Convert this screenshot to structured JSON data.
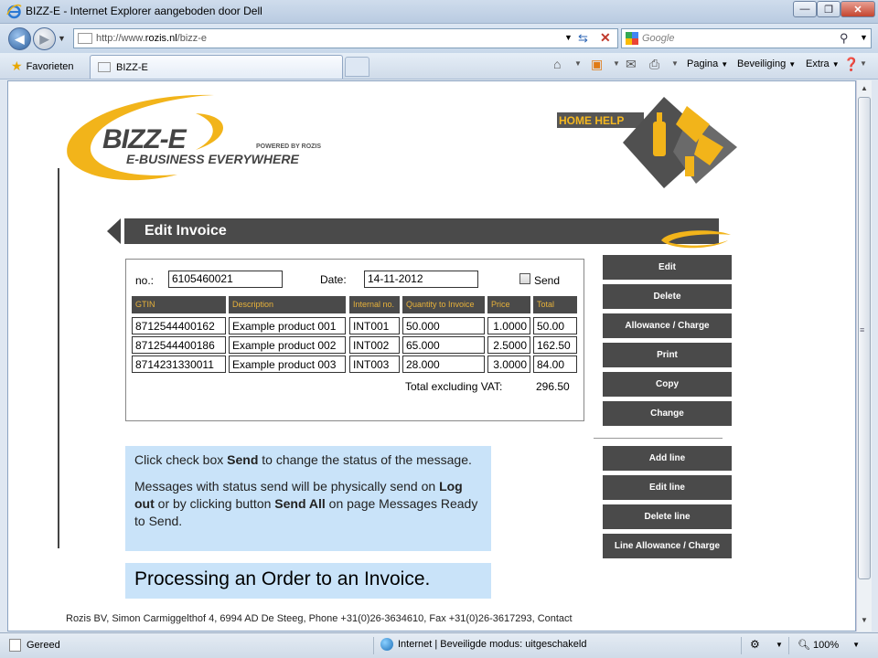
{
  "window": {
    "title": "BIZZ-E - Internet Explorer aangeboden door Dell",
    "minimize": "—",
    "maximize": "❐",
    "close": "✕"
  },
  "address_bar": {
    "url_prefix": "http://www.",
    "url_domain": "rozis.nl",
    "url_path": "/bizz-e",
    "search_placeholder": "Google"
  },
  "favorites_bar": {
    "favorites_label": "Favorieten",
    "tab_label": "BIZZ-E",
    "commands": [
      "Pagina",
      "Beveiliging",
      "Extra"
    ]
  },
  "logo": {
    "brand": "BIZZ-E",
    "tagline": "E-BUSINESS EVERYWHERE",
    "powered": "POWERED BY ROZIS",
    "colors": {
      "yellow": "#f2b41a",
      "dark": "#444444"
    }
  },
  "help": {
    "label": "HOME HELP"
  },
  "page_title": "Edit Invoice",
  "invoice": {
    "no_label": "no.:",
    "no_value": "6105460021",
    "date_label": "Date:",
    "date_value": "14-11-2012",
    "send_label": "Send",
    "send_checked": false,
    "columns": [
      "GTIN",
      "Description",
      "Internal no.",
      "Quantity to Invoice",
      "Price",
      "Total"
    ],
    "rows": [
      {
        "gtin": "8712544400162",
        "description": "Example product 001",
        "internal": "INT001",
        "quantity": "50.000",
        "price": "1.0000",
        "total": "50.00"
      },
      {
        "gtin": "8712544400186",
        "description": "Example product 002",
        "internal": "INT002",
        "quantity": "65.000",
        "price": "2.5000",
        "total": "162.50"
      },
      {
        "gtin": "8714231330011",
        "description": "Example product 003",
        "internal": "INT003",
        "quantity": "28.000",
        "price": "3.0000",
        "total": "84.00"
      }
    ],
    "total_label": "Total excluding VAT:",
    "total_value": "296.50"
  },
  "actions": [
    "Edit",
    "Delete",
    "Allowance / Charge",
    "Print",
    "Copy",
    "Change"
  ],
  "line_actions": [
    "Add line",
    "Edit line",
    "Delete line",
    "Line Allowance / Charge"
  ],
  "notes": {
    "p1_a": "Click check box ",
    "p1_b": "Send",
    "p1_c": " to change the status of the message.",
    "p2_a": "Messages with status send will be physically send on ",
    "p2_b": "Log out",
    "p2_c": " or by clicking button ",
    "p2_d": "Send All",
    "p2_e": " on page Messages Ready to Send.",
    "heading": "Processing an Order to an Invoice."
  },
  "footer": "Rozis BV, Simon Carmiggelthof 4, 6994 AD De Steeg, Phone +31(0)26-3634610, Fax +31(0)26-3617293, Contact",
  "status_bar": {
    "status": "Gereed",
    "zone": "Internet | Beveiligde modus: uitgeschakeld",
    "zoom": "100%"
  }
}
